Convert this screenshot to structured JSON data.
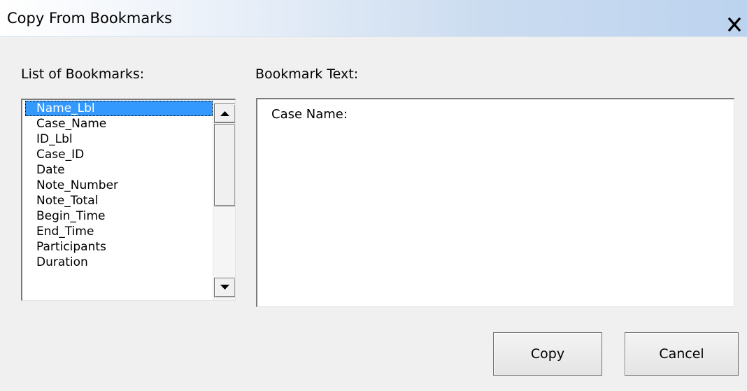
{
  "window": {
    "title": "Copy From Bookmarks"
  },
  "bookmarks": {
    "label": "List of Bookmarks:",
    "selected_index": 0,
    "items": [
      "Name_Lbl",
      "Case_Name",
      "ID_Lbl",
      "Case_ID",
      "Date",
      "Note_Number",
      "Note_Total",
      "Begin_Time",
      "End_Time",
      "Participants",
      "Duration"
    ]
  },
  "bookmark_text": {
    "label": "Bookmark Text:",
    "value": "Case Name:"
  },
  "buttons": {
    "copy": "Copy",
    "cancel": "Cancel"
  },
  "icons": {
    "close": "close-icon",
    "scroll_up": "scroll-up-arrow-icon",
    "scroll_down": "scroll-down-arrow-icon"
  },
  "colors": {
    "selection": "#3399ff",
    "titlebar_accent": "#bcd3ef"
  }
}
